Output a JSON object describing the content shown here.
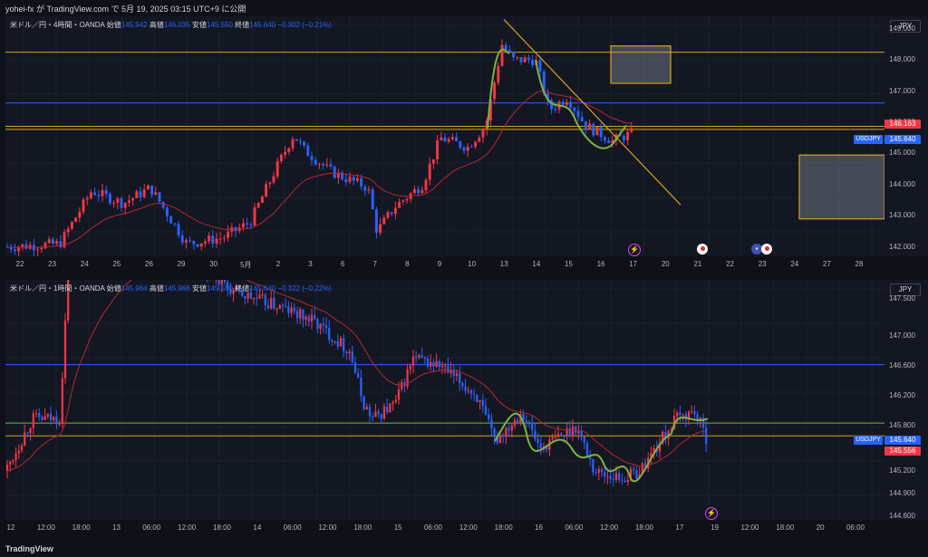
{
  "header": {
    "published": "yohei-fx が TradingView.com で 5月 19, 2025 03:15 UTC+9 に公開"
  },
  "colors": {
    "bg": "#131722",
    "up": "#f23645",
    "down": "#2962ff",
    "ma": "#b22833",
    "level": "#d6a21e",
    "blue_line": "#2962ff",
    "green_line": "#7cb342"
  },
  "top_chart": {
    "legend": {
      "symbol": "米ドル／円・4時間・OANDA",
      "o_label": "始値",
      "o": "145.942",
      "h_label": "高値",
      "h": "146.035",
      "l_label": "安値",
      "l": "145.550",
      "c_label": "終値",
      "c": "145.640",
      "chg": "−0.302 (−0.21%)"
    },
    "currency": "JPY",
    "price_ticks": [
      "149.000",
      "148.000",
      "147.000",
      "146.000",
      "145.000",
      "144.000",
      "143.000",
      "142.000"
    ],
    "tags": {
      "upper": "146.163",
      "current": "145.640",
      "symbol": "USDJPY"
    },
    "x_labels": [
      "22",
      "23",
      "24",
      "25",
      "26",
      "29",
      "30",
      "5月",
      "2",
      "3",
      "6",
      "7",
      "8",
      "9",
      "10",
      "13",
      "14",
      "15",
      "16",
      "17",
      "20",
      "21",
      "22",
      "23",
      "24",
      "27",
      "28"
    ],
    "events": [
      {
        "icon": "flash-icon"
      },
      {
        "icon": "jp-flag-icon"
      },
      {
        "icon": "us-flag-icon"
      },
      {
        "icon": "jp-flag-icon"
      }
    ],
    "chart_data": {
      "type": "candlestick",
      "ylim": [
        141.7,
        149.4
      ],
      "levels": [
        148.25,
        145.87,
        145.77
      ],
      "blue_level": 146.62,
      "zones": [
        [
          147.25,
          148.45
        ],
        [
          142.9,
          144.95
        ]
      ]
    }
  },
  "bottom_chart": {
    "legend": {
      "symbol": "米ドル／円・1時間・OANDA",
      "o_label": "始値",
      "o": "145.964",
      "h_label": "高値",
      "h": "145.966",
      "l_label": "安値",
      "l": "145.550",
      "c_label": "終値",
      "c": "145.640",
      "chg": "−0.322 (−0.22%)"
    },
    "currency": "JPY",
    "price_ticks": [
      "147.500",
      "147.000",
      "146.600",
      "146.200",
      "145.800",
      "145.200",
      "144.900",
      "144.600"
    ],
    "tags": {
      "current": "145.640",
      "ma": "145.556",
      "symbol": "USDJPY"
    },
    "x_labels": [
      "12",
      "12:00",
      "18:00",
      "13",
      "06:00",
      "12:00",
      "18:00",
      "14",
      "06:00",
      "12:00",
      "18:00",
      "15",
      "06:00",
      "12:00",
      "18:00",
      "16",
      "06:00",
      "12:00",
      "18:00",
      "17",
      "19",
      "12:00",
      "18:00",
      "20",
      "06:00"
    ],
    "events": [
      {
        "icon": "flash-icon"
      }
    ],
    "chart_data": {
      "type": "candlestick",
      "ylim": [
        144.55,
        147.75
      ],
      "levels": [
        145.84,
        145.67
      ],
      "blue_level": 146.62
    }
  },
  "footer": {
    "brand": "TradingView"
  }
}
